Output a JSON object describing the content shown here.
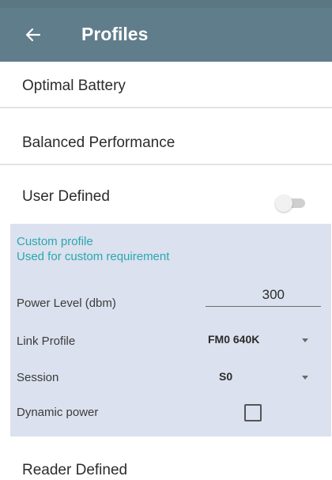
{
  "app_bar": {
    "title": "Profiles",
    "back_icon": "arrow-left-icon"
  },
  "profiles": {
    "optimal_battery": "Optimal Battery",
    "balanced_performance": "Balanced Performance",
    "user_defined": "User Defined",
    "user_defined_toggle_on": false,
    "reader_defined": "Reader Defined"
  },
  "custom_panel": {
    "title": "Custom profile",
    "subtitle": "Used for custom requirement",
    "power_level_label": "Power Level (dbm)",
    "power_level_value": "300",
    "link_profile_label": "Link Profile",
    "link_profile_value": "FM0 640K",
    "session_label": "Session",
    "session_value": "S0",
    "dynamic_power_label": "Dynamic power",
    "dynamic_power_checked": false
  },
  "colors": {
    "app_bar": "#607d8b",
    "panel_bg": "#dbe1ee",
    "accent_text": "#2aa7b0"
  }
}
